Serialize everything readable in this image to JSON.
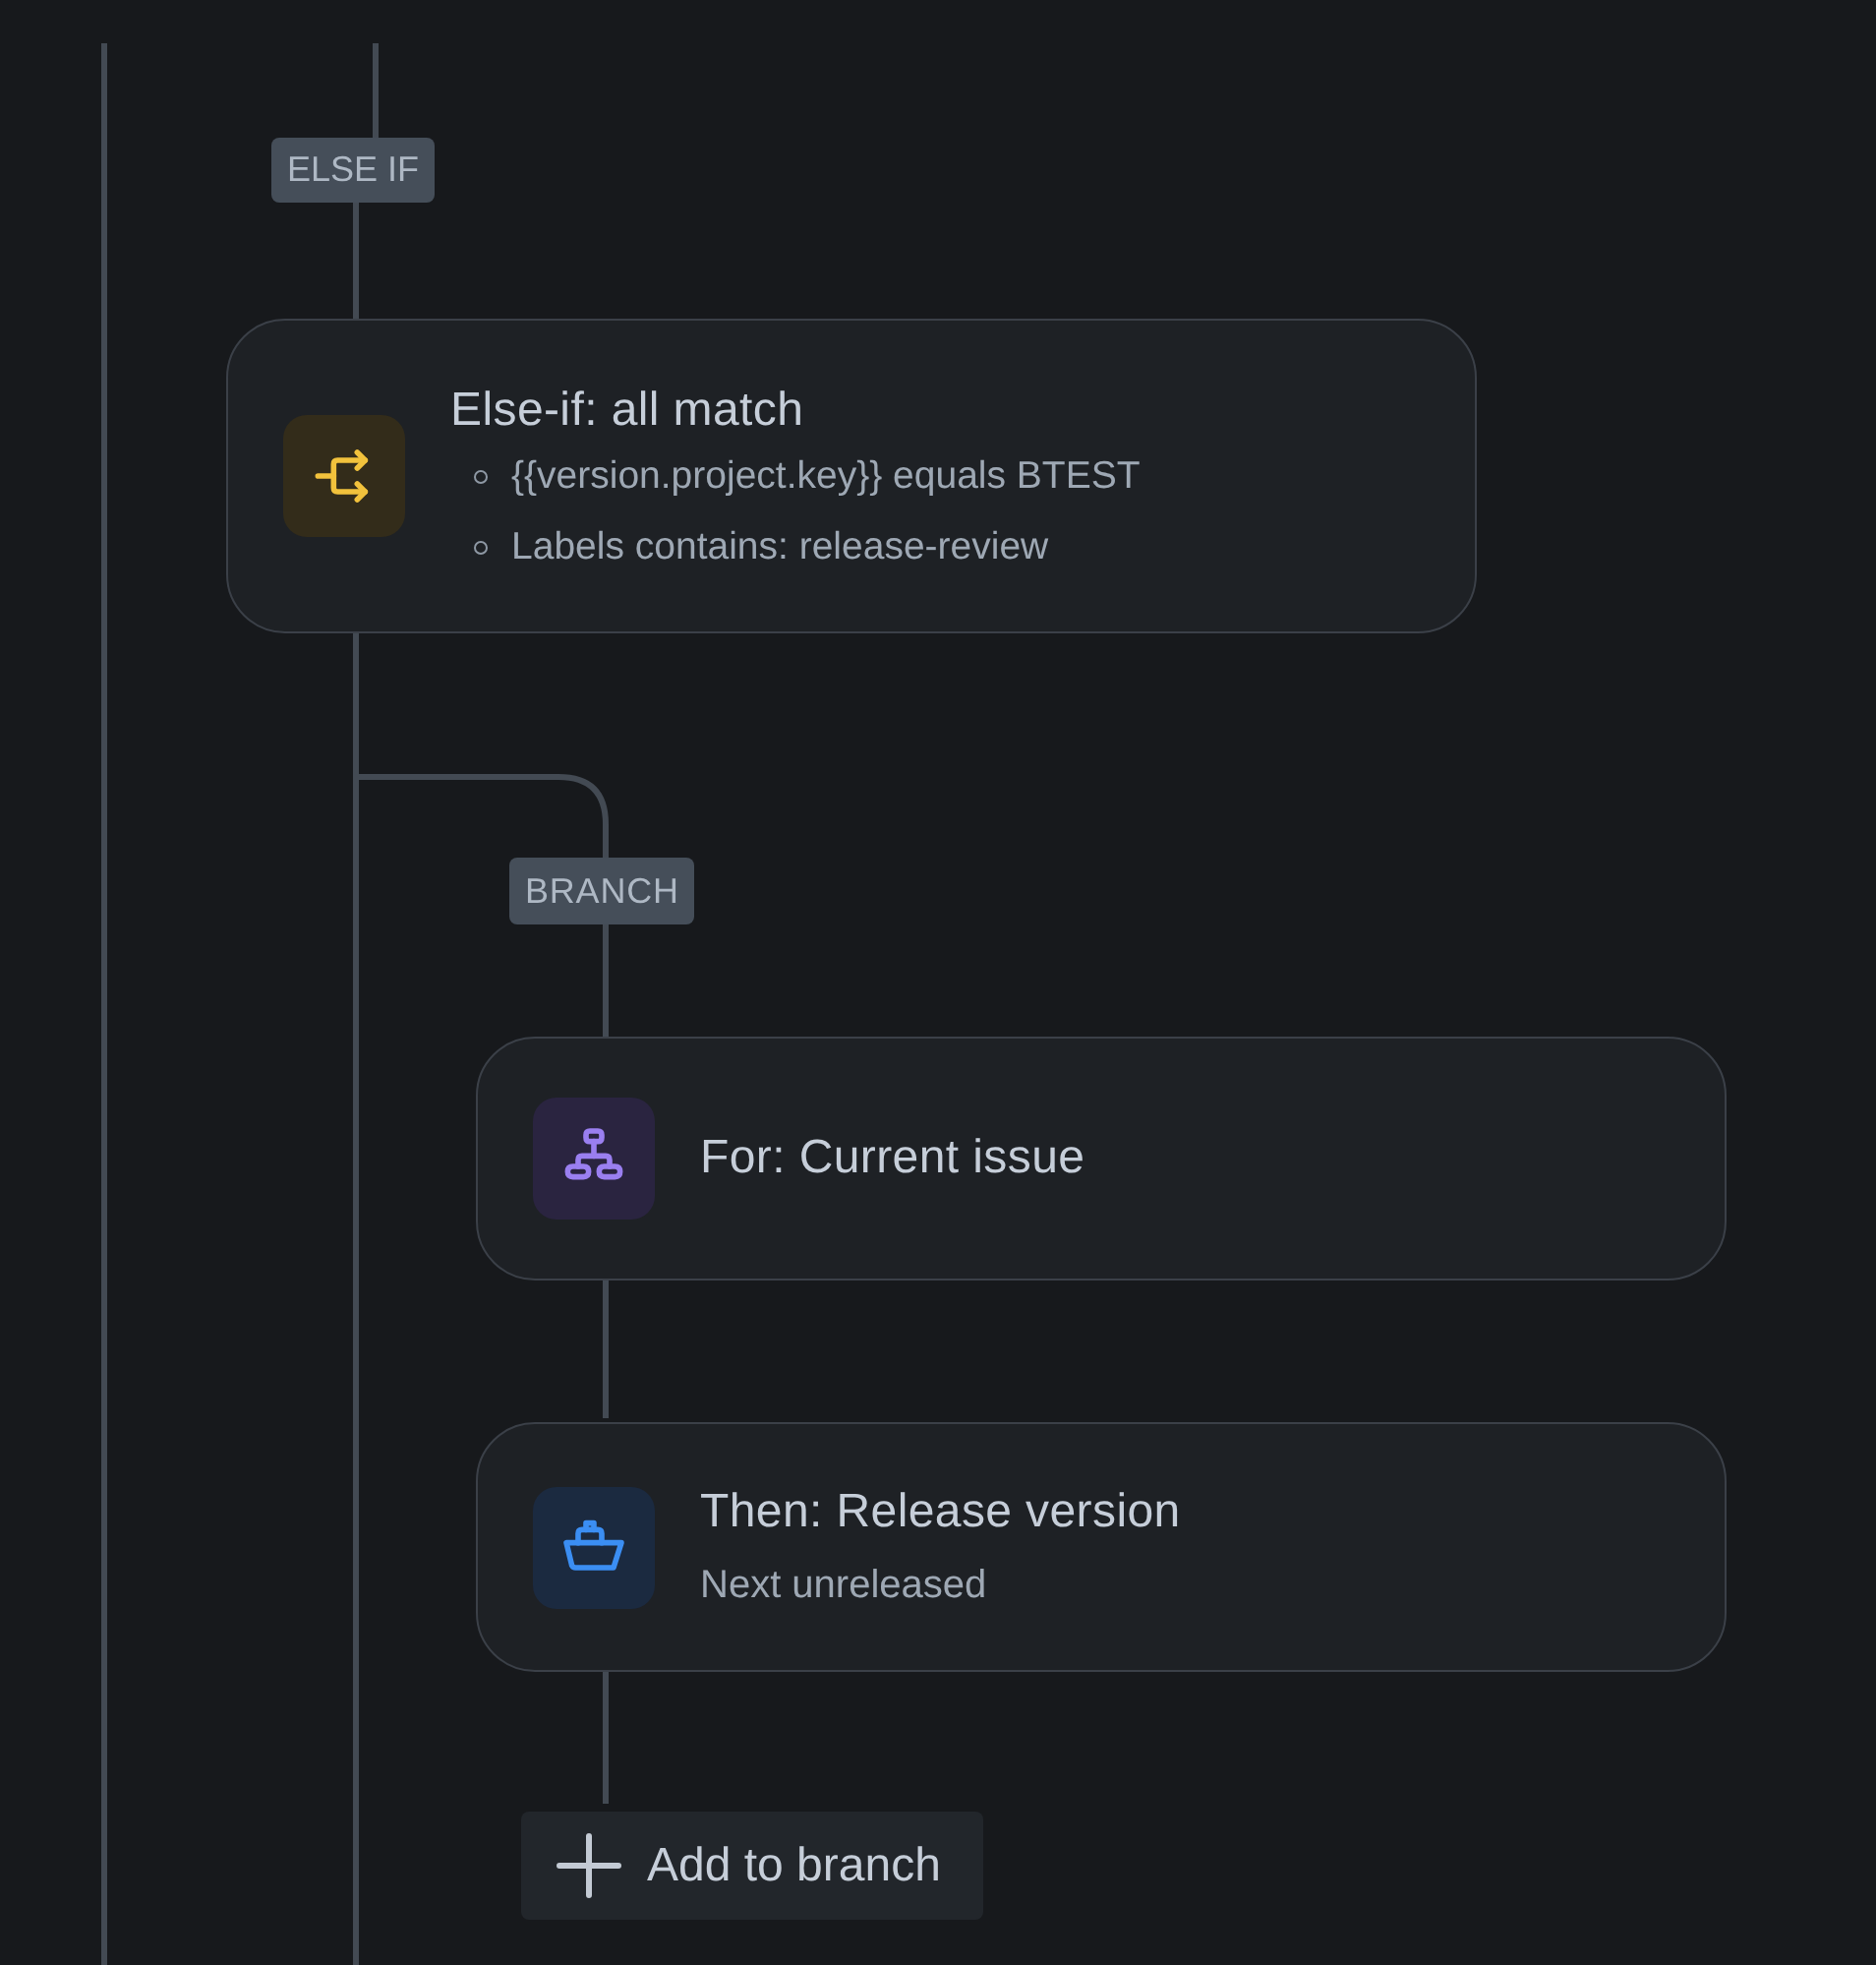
{
  "else_if": {
    "label": "ELSE IF",
    "card": {
      "kind": "condition",
      "title": "Else-if: all match",
      "conditions": [
        "{{version.project.key}} equals BTEST",
        "Labels contains: release-review"
      ]
    }
  },
  "branch": {
    "label": "BRANCH",
    "steps": [
      {
        "kind": "for_each",
        "title": "For: Current issue"
      },
      {
        "kind": "action",
        "title": "Then: Release version",
        "subtitle": "Next unreleased"
      }
    ],
    "add_button": "Add to branch"
  }
}
